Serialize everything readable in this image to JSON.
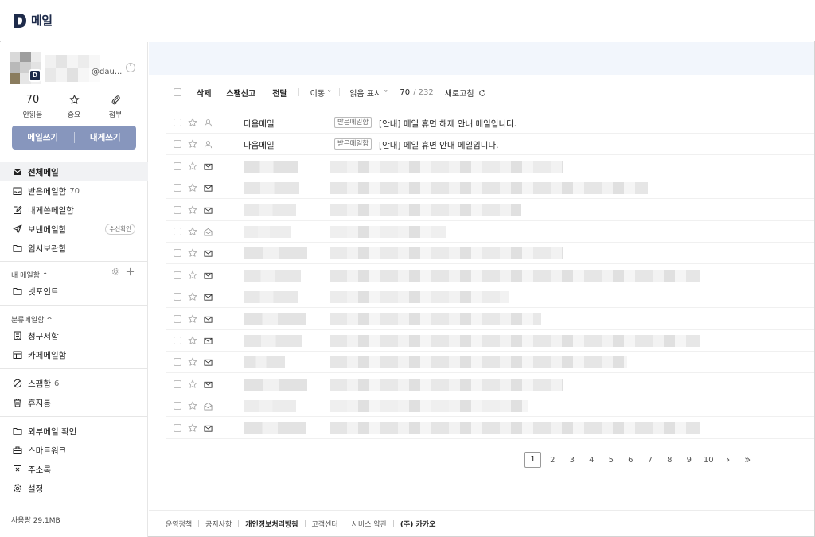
{
  "header": {
    "app_title": "메일",
    "logo_letter": "D"
  },
  "profile": {
    "email_suffix": "@dau...",
    "badge_letter": "D"
  },
  "quick": [
    {
      "value": "70",
      "label": "안읽음"
    },
    {
      "icon": "star-icon",
      "label": "중요"
    },
    {
      "icon": "paperclip-icon",
      "label": "첨부"
    }
  ],
  "compose": {
    "write": "메일쓰기",
    "self": "내게쓰기"
  },
  "nav_main": [
    {
      "icon": "mail-filled-icon",
      "label": "전체메일",
      "count": "",
      "active": true
    },
    {
      "icon": "inbox-icon",
      "label": "받은메일함",
      "count": "70"
    },
    {
      "icon": "edit-icon",
      "label": "내게쓴메일함",
      "count": ""
    },
    {
      "icon": "send-icon",
      "label": "보낸메일함",
      "count": "",
      "tag": "수신확인"
    },
    {
      "icon": "folder-icon",
      "label": "임시보관함",
      "count": ""
    }
  ],
  "my_folders": {
    "title": "내 메일함 ^",
    "items": [
      {
        "icon": "folder-icon",
        "label": "넷포인트"
      }
    ]
  },
  "categories": {
    "title": "분류메일함 ^",
    "items": [
      {
        "icon": "receipt-icon",
        "label": "청구서함"
      },
      {
        "icon": "cafe-icon",
        "label": "카페메일함"
      }
    ]
  },
  "nav_misc": [
    {
      "icon": "block-icon",
      "label": "스팸함",
      "count": "6"
    },
    {
      "icon": "trash-icon",
      "label": "휴지통",
      "count": ""
    }
  ],
  "nav_tools": [
    {
      "icon": "folder-icon",
      "label": "외부메일 확인"
    },
    {
      "icon": "briefcase-icon",
      "label": "스마트워크"
    },
    {
      "icon": "contacts-icon",
      "label": "주소록"
    },
    {
      "icon": "gear-icon",
      "label": "설정"
    }
  ],
  "usage": "사용량 29.1MB",
  "toolbar": {
    "delete": "삭제",
    "spam": "스팸신고",
    "forward": "전달",
    "move": "이동 ˅",
    "read_mark": "읽음 표시 ˅",
    "count": "70",
    "total": "/ 232",
    "refresh": "새로고침"
  },
  "mails": [
    {
      "sender": "다음메일",
      "folder": "받은메일함",
      "subject": "[안내] 메일 휴면 해제 안내 메일입니다.",
      "type": "person-icon",
      "blurred": false
    },
    {
      "sender": "다음메일",
      "folder": "받은메일함",
      "subject": "[안내] 메일 휴면 안내 메일입니다.",
      "type": "person-icon",
      "blurred": false
    },
    {
      "type": "envelope-icon",
      "blurred": true
    },
    {
      "type": "envelope-icon",
      "blurred": true
    },
    {
      "type": "envelope-icon",
      "blurred": true
    },
    {
      "type": "open-envelope-icon",
      "blurred": true
    },
    {
      "type": "envelope-icon",
      "blurred": true
    },
    {
      "type": "envelope-icon",
      "blurred": true
    },
    {
      "type": "envelope-icon",
      "blurred": true
    },
    {
      "type": "envelope-icon",
      "blurred": true
    },
    {
      "type": "envelope-icon",
      "blurred": true
    },
    {
      "type": "envelope-icon",
      "blurred": true
    },
    {
      "type": "envelope-icon",
      "blurred": true
    },
    {
      "type": "open-envelope-icon",
      "blurred": true
    },
    {
      "type": "envelope-icon",
      "blurred": true
    }
  ],
  "pagination": {
    "current": "1",
    "pages": [
      "2",
      "3",
      "4",
      "5",
      "6",
      "7",
      "8",
      "9",
      "10"
    ],
    "next": "›",
    "last": "»"
  },
  "footer": [
    {
      "label": "운영정책",
      "bold": false
    },
    {
      "label": "공지사항",
      "bold": false
    },
    {
      "label": "개인정보처리방침",
      "bold": true
    },
    {
      "label": "고객센터",
      "bold": false
    },
    {
      "label": "서비스 약관",
      "bold": false
    },
    {
      "label": "(주) 카카오",
      "bold": true
    }
  ],
  "colors": {
    "accent": "#8796bd",
    "brand": "#1e2b4a",
    "banner": "#f2f6fc"
  }
}
